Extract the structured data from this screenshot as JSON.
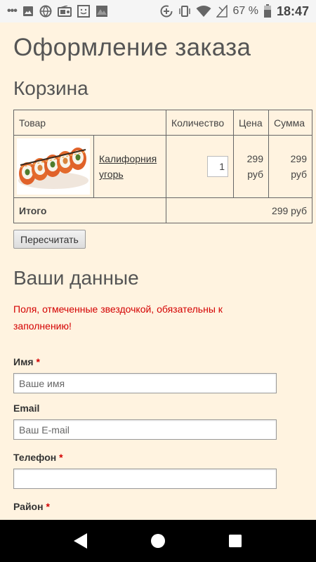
{
  "status_bar": {
    "battery_percent": "67 %",
    "time": "18:47",
    "icons": [
      "dots-icon",
      "image-icon",
      "globe-icon",
      "radio-icon",
      "face-icon",
      "photo-icon",
      "data-saver-icon",
      "vibrate-icon",
      "wifi-icon",
      "signal-icon",
      "battery-icon"
    ]
  },
  "page": {
    "title": "Оформление заказа",
    "cart_title": "Корзина"
  },
  "cart": {
    "headers": {
      "product": "Товар",
      "quantity": "Количество",
      "price": "Цена",
      "sum": "Сумма"
    },
    "items": [
      {
        "name": "Калифорния угорь",
        "quantity": "1",
        "price": "299 руб",
        "sum": "299 руб"
      }
    ],
    "total_label": "Итого",
    "total_value": "299 руб",
    "recalc_label": "Пересчитать"
  },
  "form": {
    "title": "Ваши данные",
    "required_note": "Поля, отмеченные звездочкой, обязательны к заполнению!",
    "fields": {
      "name": {
        "label": "Имя",
        "required": "*",
        "value": "",
        "placeholder": "Ваше имя"
      },
      "email": {
        "label": "Email",
        "value": "",
        "placeholder": "Ваш E-mail"
      },
      "phone": {
        "label": "Телефон",
        "required": "*",
        "value": "",
        "placeholder": ""
      },
      "district": {
        "label": "Район",
        "required": "*"
      }
    }
  },
  "nav_bar": {
    "buttons": [
      "back-icon",
      "home-icon",
      "recents-icon"
    ]
  },
  "colors": {
    "background": "#fff3e0",
    "required": "#d40000",
    "heading": "#555555"
  }
}
